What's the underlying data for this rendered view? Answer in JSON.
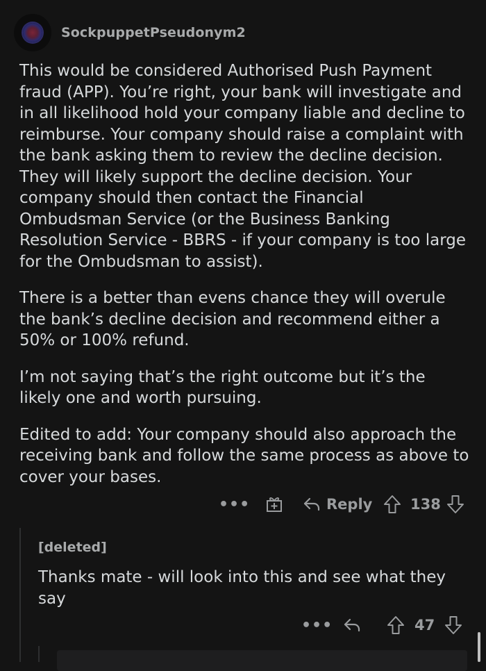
{
  "comment": {
    "username": "SockpuppetPseudonym2",
    "paragraphs": [
      "This would be considered Authorised Push Payment fraud (APP). You’re right, your bank will investigate and in all likelihood hold your company liable and decline to reimburse. Your company should raise a complaint with the bank asking them to review the decline decision. They will likely support the decline decision. Your company should then contact the Financial Ombudsman Service (or the Business Banking Resolution Service - BBRS - if your company is too large for the Ombudsman to assist).",
      "There is a better than evens chance they will overule the bank’s decline decision and recommend either a 50% or 100% refund.",
      "I’m not saying that’s the right outcome but it’s the likely one and worth pursuing.",
      "Edited to add: Your company should also approach the receiving bank and follow the same process as above to cover your bases."
    ],
    "actions": {
      "more": "•••",
      "reply_label": "Reply",
      "score": "138"
    }
  },
  "reply": {
    "author": "[deleted]",
    "body": "Thanks mate - will look into this and see what they say",
    "actions": {
      "more": "•••",
      "score": "47"
    }
  },
  "icons": {
    "avatar": "snoo-avatar",
    "award": "award-gift-icon",
    "reply": "reply-arrow-icon",
    "upvote": "upvote-arrow-icon",
    "downvote": "downvote-arrow-icon"
  },
  "colors": {
    "background": "#141414",
    "text": "#d7dadc",
    "muted": "#9a9c9e"
  }
}
